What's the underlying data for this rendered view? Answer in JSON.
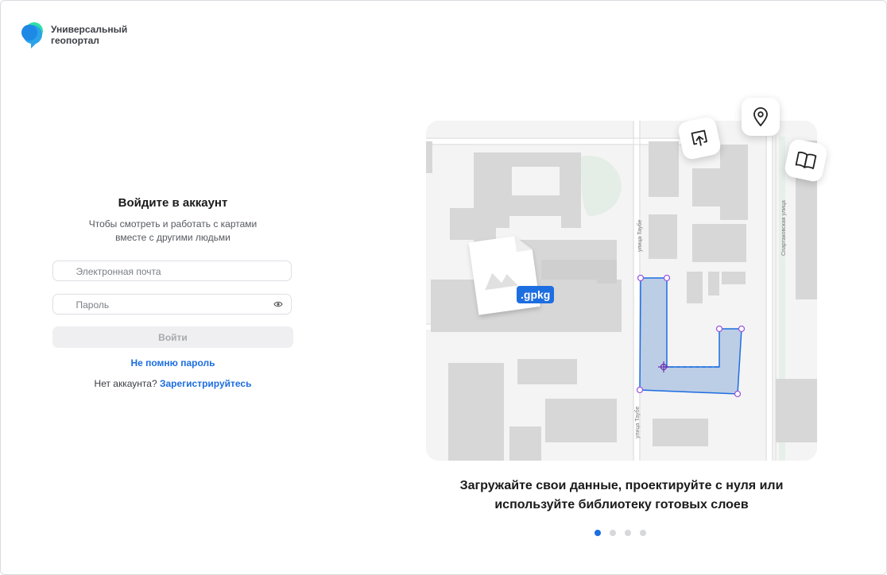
{
  "brand": {
    "name": "Универсальный геопортал",
    "logo_icon": "balloon-logo-icon"
  },
  "login": {
    "title": "Войдите в аккаунт",
    "subtitle": "Чтобы смотреть и работать с картами вместе с другими людьми",
    "email_placeholder": "Электронная почта",
    "password_placeholder": "Пароль",
    "submit_label": "Войти",
    "forgot_label": "Не помню пароль",
    "no_account_text": "Нет аккаунта?",
    "register_label": "Зарегистрируйтесь"
  },
  "promo": {
    "file_badge": ".gpkg",
    "street_labels": [
      "улица Таубе",
      "улица Таубе",
      "Спартаковская улица"
    ],
    "caption": "Загружайте свои данные, проектируйте с нуля или используйте библиотеку готовых слоев",
    "icons": [
      "upload-icon",
      "map-pin-icon",
      "book-icon"
    ],
    "slides_total": 4,
    "active_slide": 1
  },
  "colors": {
    "accent": "#1d6ee0",
    "polygon_fill": "#bccde6",
    "polygon_vertex": "#9b59e0"
  }
}
